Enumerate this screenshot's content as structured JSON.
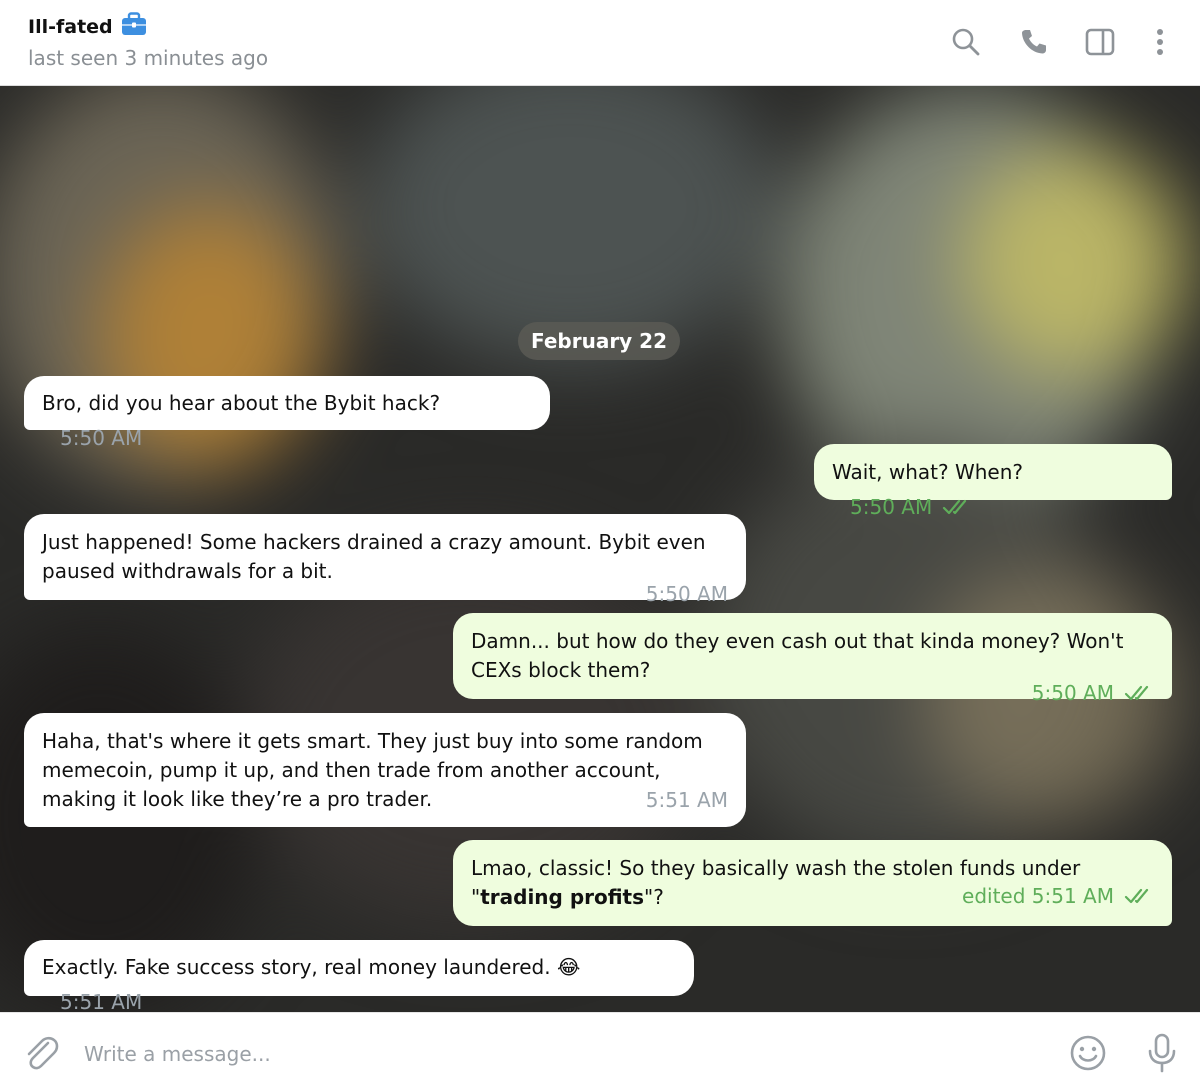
{
  "header": {
    "contact_name": "Ill-fated",
    "contact_status": "last seen 3 minutes ago",
    "icons": [
      "briefcase-icon",
      "search-icon",
      "phone-icon",
      "sidebar-toggle-icon",
      "more-vertical-icon"
    ]
  },
  "chat": {
    "date_label": "February 22",
    "messages": [
      {
        "direction": "in",
        "text": "Bro, did you hear about the Bybit hack?",
        "time": "5:50 AM"
      },
      {
        "direction": "out",
        "text": "Wait, what? When?",
        "time": "5:50 AM",
        "status": "read"
      },
      {
        "direction": "in",
        "text": "Just happened! Some hackers drained a crazy amount. Bybit even paused withdrawals for a bit.",
        "time": "5:50 AM"
      },
      {
        "direction": "out",
        "text": "Damn... but how do they even cash out that kinda money? Won't CEXs block them?",
        "time": "5:50 AM",
        "status": "read"
      },
      {
        "direction": "in",
        "text": "Haha, that's where it gets smart. They just buy into some random memecoin, pump it up, and then trade from another account, making it look like they’re a pro trader.",
        "time": "5:51 AM"
      },
      {
        "direction": "out",
        "text_before": "Lmao, classic! So they basically wash the stolen funds under \"",
        "text_bold": "trading profits",
        "text_after": "\"?",
        "time": "edited 5:51 AM",
        "status": "read"
      },
      {
        "direction": "in",
        "text": "Exactly. Fake success story, real money laundered.",
        "emoji": "😂",
        "time": "5:51 AM"
      }
    ]
  },
  "composer": {
    "placeholder": "Write a message...",
    "value": ""
  },
  "colors": {
    "incoming_bubble": "#ffffff",
    "outgoing_bubble": "#effdde",
    "outgoing_meta": "#5fae5a",
    "incoming_meta": "#9aa3ab"
  }
}
